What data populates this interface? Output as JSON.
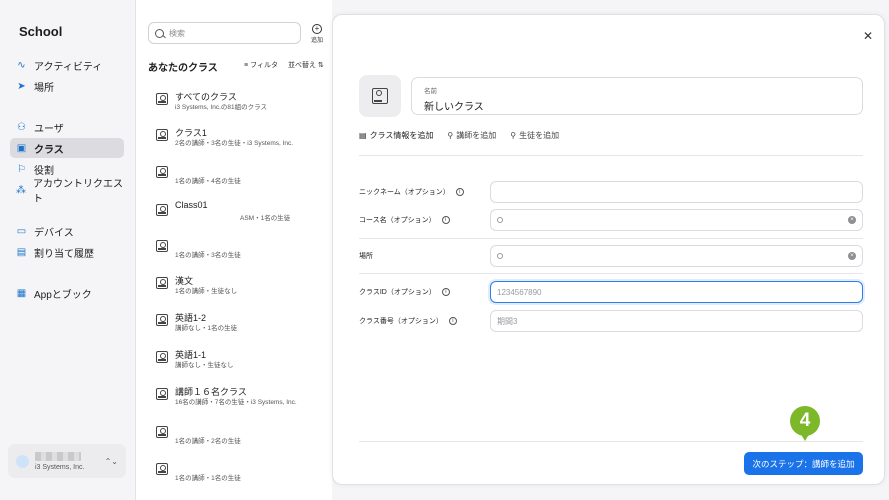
{
  "sidebar": {
    "brand": "School",
    "items": [
      {
        "label": "アクティビティ",
        "icon": "activity-icon"
      },
      {
        "label": "場所",
        "icon": "location-arrow-icon"
      },
      {
        "label": "ユーザ",
        "icon": "users-icon"
      },
      {
        "label": "クラス",
        "icon": "class-icon"
      },
      {
        "label": "役割",
        "icon": "flag-icon"
      },
      {
        "label": "アカウントリクエスト",
        "icon": "account-request-icon"
      },
      {
        "label": "デバイス",
        "icon": "device-icon"
      },
      {
        "label": "割り当て履歴",
        "icon": "history-icon"
      },
      {
        "label": "Appとブック",
        "icon": "apps-books-icon"
      }
    ],
    "account_org": "i3 Systems, Inc."
  },
  "list": {
    "search_placeholder": "検索",
    "add_label": "追加",
    "title": "あなたのクラス",
    "filter_label": "フィルタ",
    "sort_label": "並べ替え",
    "classes": [
      {
        "name": "すべてのクラス",
        "sub": "i3 Systems, Inc.の81組のクラス"
      },
      {
        "name": "クラス1",
        "sub": "2名の講師・3名の生徒・i3 Systems, Inc."
      },
      {
        "name": "",
        "sub": "1名の講師・4名の生徒"
      },
      {
        "name": "Class01",
        "sub": "ASM・1名の生徒"
      },
      {
        "name": "",
        "sub": "1名の講師・3名の生徒"
      },
      {
        "name": "漢文",
        "sub": "1名の講師・生徒なし"
      },
      {
        "name": "英語1-2",
        "sub": "講師なし・1名の生徒"
      },
      {
        "name": "英語1-1",
        "sub": "講師なし・生徒なし"
      },
      {
        "name": "講師１６名クラス",
        "sub": "16名の講師・7名の生徒・i3 Systems, Inc."
      },
      {
        "name": "",
        "sub": "1名の講師・2名の生徒"
      },
      {
        "name": "",
        "sub": "1名の講師・1名の生徒"
      }
    ]
  },
  "panel": {
    "name_label": "名前",
    "name_value": "新しいクラス",
    "tabs": [
      "クラス情報を追加",
      "講師を追加",
      "生徒を追加"
    ],
    "fields": {
      "nickname_label": "ニックネーム（オプション）",
      "course_label": "コース名（オプション）",
      "location_label": "場所",
      "classid_label": "クラスID（オプション）",
      "classid_placeholder": "1234567890",
      "classnum_label": "クラス番号（オプション）",
      "classnum_placeholder": "期間3"
    },
    "next_button": "次のステップ：講師を追加",
    "step_badge": "4"
  },
  "colors": {
    "accent": "#1a73e8",
    "badge": "#7cb82a"
  }
}
